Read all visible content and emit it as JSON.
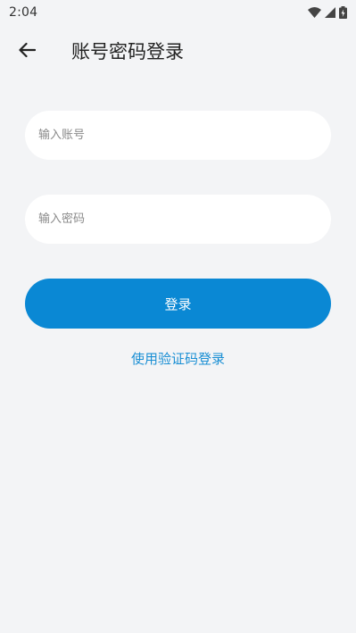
{
  "status_bar": {
    "time": "2:04",
    "icons": [
      "wifi-icon",
      "signal-icon",
      "battery-icon"
    ]
  },
  "app_bar": {
    "back_icon": "arrow-left-icon",
    "title": "账号密码登录"
  },
  "form": {
    "account_placeholder": "输入账号",
    "account_value": "",
    "password_placeholder": "输入密码",
    "password_value": "",
    "login_label": "登录",
    "alt_login_label": "使用验证码登录"
  },
  "colors": {
    "background": "#f3f4f6",
    "primary": "#0a88d4",
    "link": "#1a8fd4",
    "input_bg": "#ffffff"
  }
}
